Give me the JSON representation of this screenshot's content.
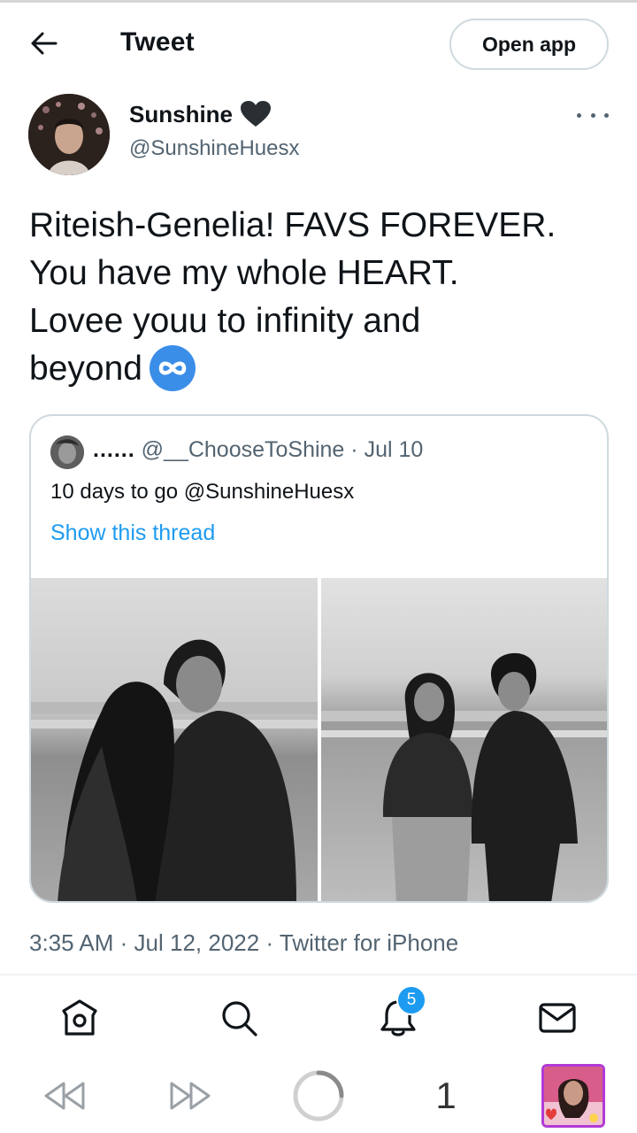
{
  "header": {
    "title": "Tweet",
    "open_app_label": "Open app"
  },
  "author": {
    "name": "Sunshine",
    "name_emoji": "black-heart-icon",
    "handle": "@SunshineHuesx"
  },
  "tweet": {
    "lines": [
      "Riteish-Genelia! FAVS FOREVER.",
      "You have my whole HEART.",
      "Lovee youu to infinity and",
      "beyond"
    ],
    "emoji": "infinity-icon"
  },
  "quote": {
    "author_name": "......",
    "handle": "@__ChooseToShine",
    "date": "Jul 10",
    "text": "10 days to go @SunshineHuesx",
    "thread_link": "Show this thread",
    "separator": "·"
  },
  "timestamp": {
    "time": "3:35 AM",
    "date": "Jul 12, 2022",
    "source": "Twitter for iPhone",
    "separator": "·"
  },
  "tabs": {
    "items": [
      "home-icon",
      "search-icon",
      "notifications-icon",
      "messages-icon"
    ],
    "notification_count": "5"
  },
  "browser": {
    "tab_count": "1"
  },
  "colors": {
    "link": "#1d9bf0",
    "secondary_text": "#536471",
    "border": "#cfd9de",
    "badge": "#1d9bf0"
  }
}
